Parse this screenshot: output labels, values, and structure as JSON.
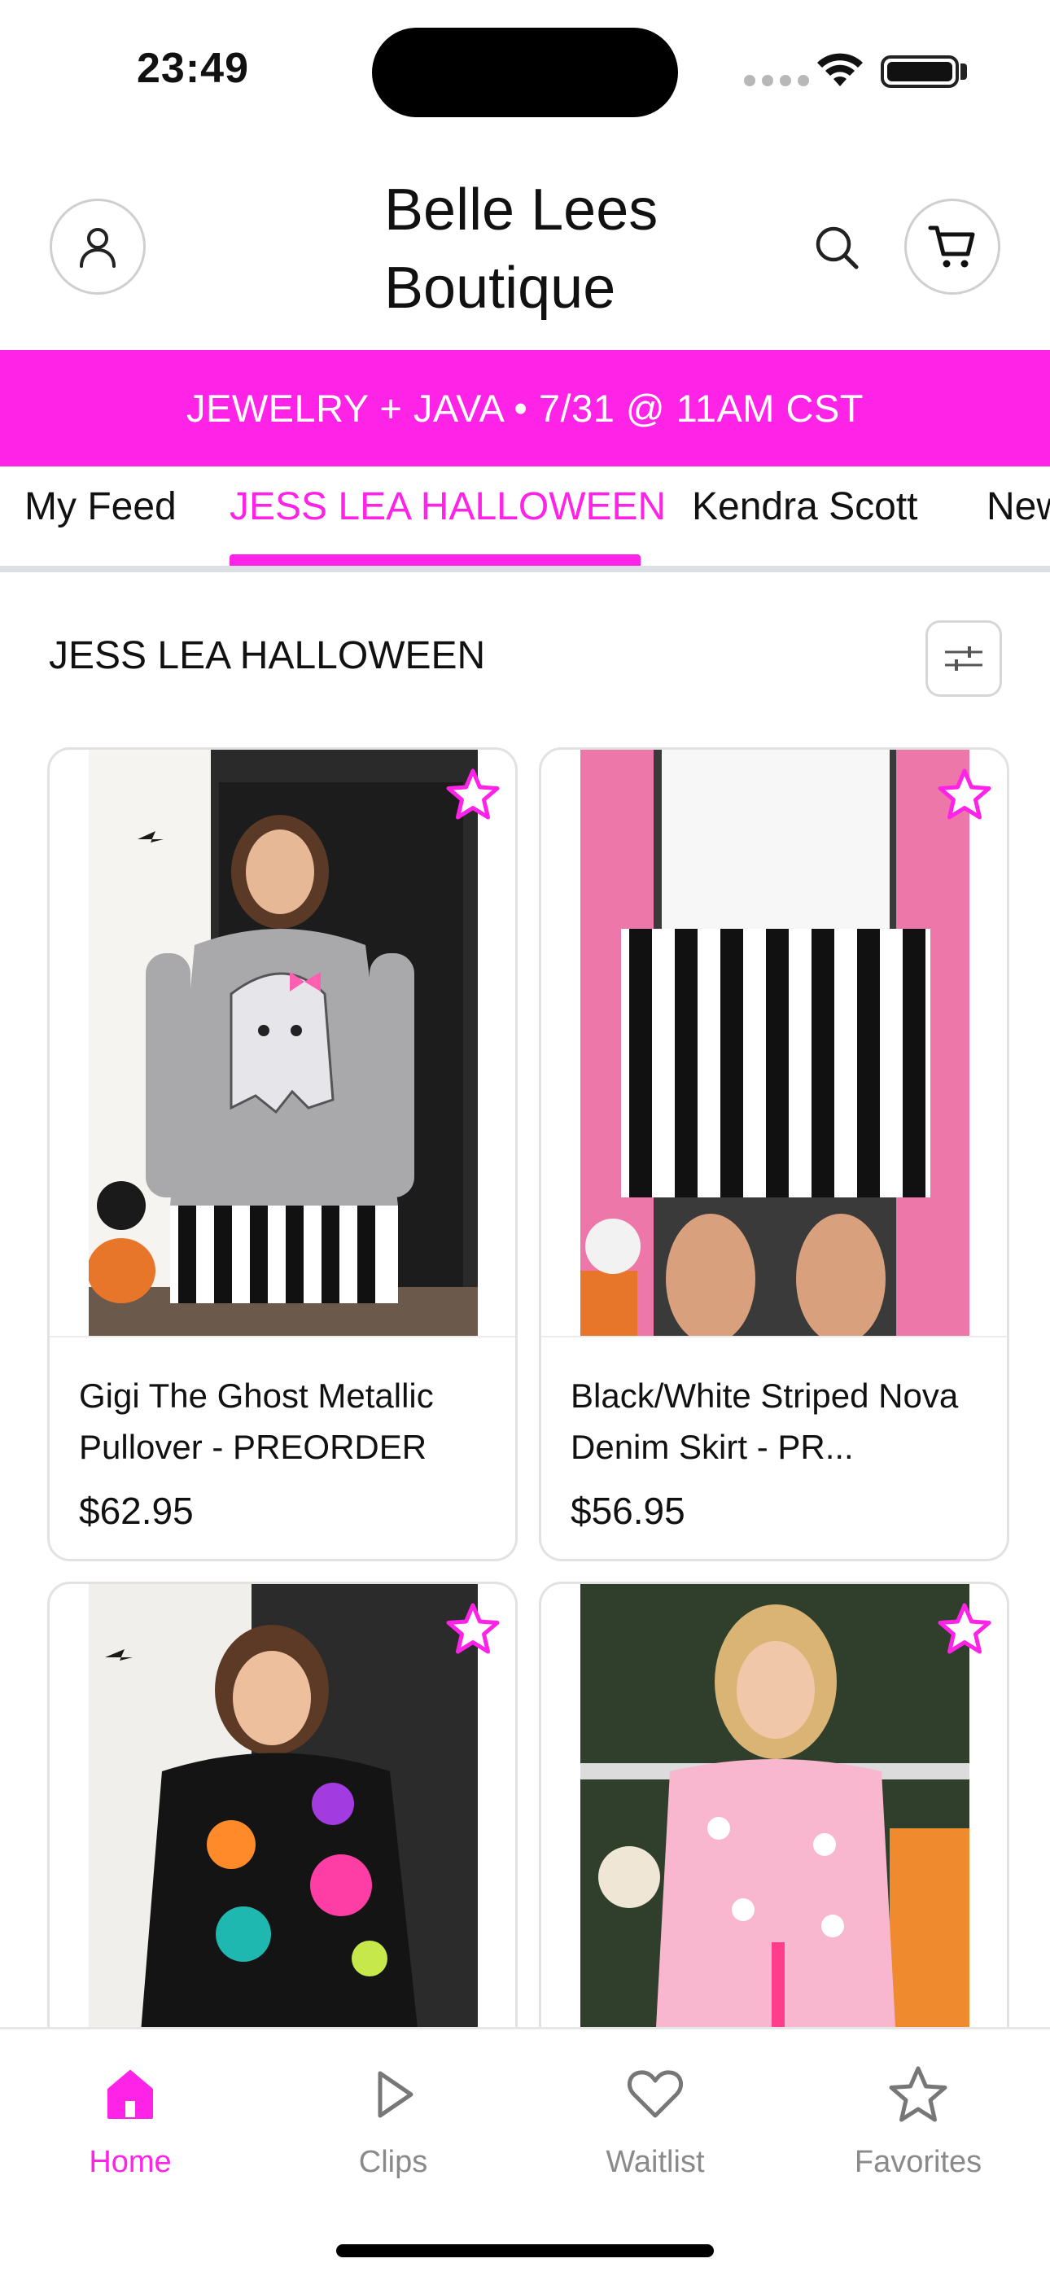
{
  "status_bar": {
    "time": "23:49"
  },
  "header": {
    "store_name_line1": "Belle Lees",
    "store_name_line2": "Boutique",
    "icons": [
      "user-icon",
      "search-icon",
      "cart-icon"
    ]
  },
  "banner": {
    "text": "JEWELRY + JAVA • 7/31 @ 11AM CST"
  },
  "tabs": [
    {
      "label": "My Feed",
      "active": false
    },
    {
      "label": "JESS LEA HALLOWEEN",
      "active": true
    },
    {
      "label": "Kendra Scott",
      "active": false
    },
    {
      "label": "New",
      "active": false
    }
  ],
  "section": {
    "title": "JESS LEA HALLOWEEN"
  },
  "products": [
    {
      "name": "Gigi The Ghost Metallic Pullover - PREORDER",
      "price": "$62.95"
    },
    {
      "name": "Black/White Striped Nova Denim Skirt - PR...",
      "price": "$56.95"
    },
    {
      "name": "",
      "price": ""
    },
    {
      "name": "",
      "price": ""
    }
  ],
  "bottom_nav": [
    {
      "label": "Home",
      "icon": "home-icon",
      "active": true
    },
    {
      "label": "Clips",
      "icon": "play-icon",
      "active": false
    },
    {
      "label": "Waitlist",
      "icon": "heart-icon",
      "active": false
    },
    {
      "label": "Favorites",
      "icon": "star-icon",
      "active": false
    }
  ],
  "colors": {
    "accent": "#ff22e7",
    "text": "#111111",
    "muted": "#8a8a8a"
  }
}
